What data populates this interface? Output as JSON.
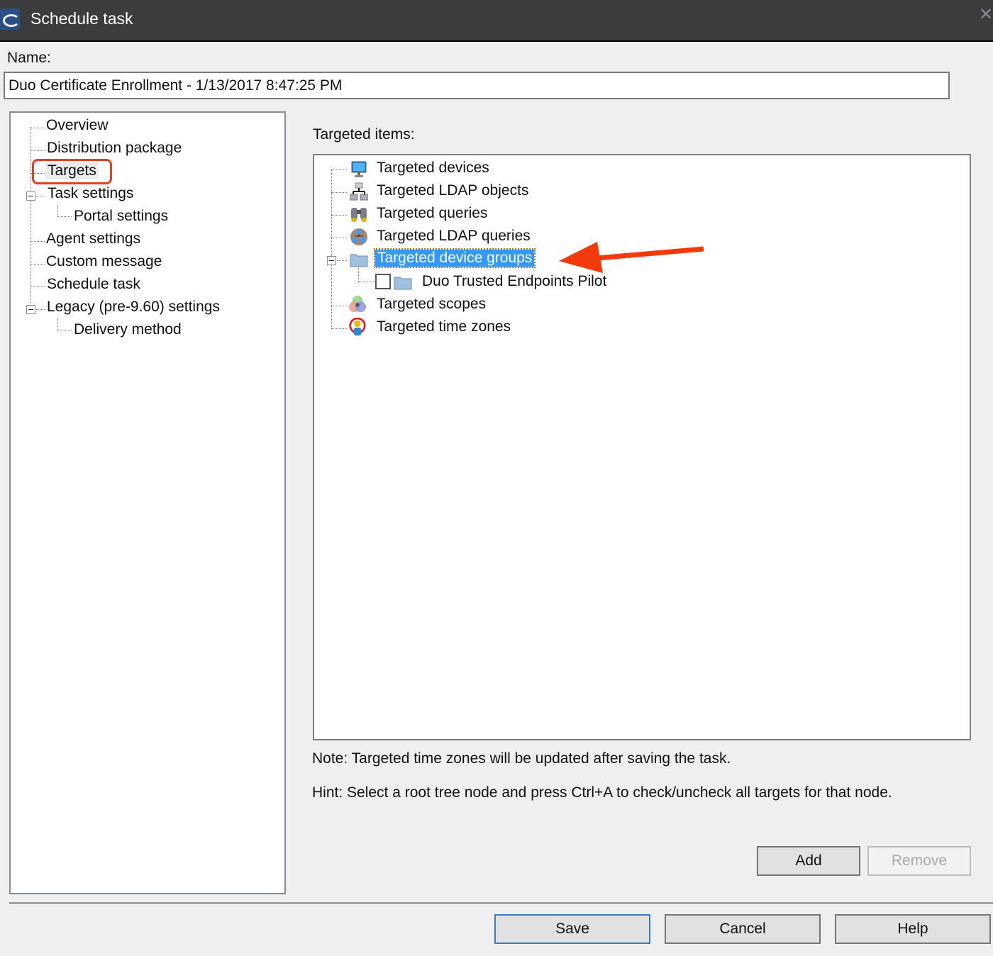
{
  "window": {
    "title": "Schedule task",
    "app_icon": "ivanti-task-icon",
    "close_icon": "close-icon"
  },
  "name_field": {
    "label": "Name:",
    "value": "Duo Certificate Enrollment - 1/13/2017 8:47:25 PM"
  },
  "nav_tree": {
    "items": [
      {
        "label": "Overview",
        "level": 0
      },
      {
        "label": "Distribution package",
        "level": 0
      },
      {
        "label": "Targets",
        "level": 0,
        "highlighted": true
      },
      {
        "label": "Task settings",
        "level": 0,
        "expanded": true
      },
      {
        "label": "Portal settings",
        "level": 1
      },
      {
        "label": "Agent settings",
        "level": 0
      },
      {
        "label": "Custom message",
        "level": 0
      },
      {
        "label": "Schedule task",
        "level": 0
      },
      {
        "label": "Legacy (pre-9.60) settings",
        "level": 0,
        "expanded": true
      },
      {
        "label": "Delivery method",
        "level": 1
      }
    ]
  },
  "targets": {
    "label": "Targeted items:",
    "items": [
      {
        "label": "Targeted devices",
        "icon": "monitor-icon"
      },
      {
        "label": "Targeted LDAP objects",
        "icon": "ldap-hierarchy-icon"
      },
      {
        "label": "Targeted queries",
        "icon": "binoculars-icon"
      },
      {
        "label": "Targeted LDAP queries",
        "icon": "ldap-query-icon"
      },
      {
        "label": "Targeted device groups",
        "icon": "folder-icon",
        "selected": true,
        "expanded": true,
        "children": [
          {
            "label": "Duo Trusted Endpoints Pilot",
            "icon": "folder-icon",
            "checked": false
          }
        ]
      },
      {
        "label": "Targeted scopes",
        "icon": "scopes-icon"
      },
      {
        "label": "Targeted time zones",
        "icon": "time-zone-person-icon"
      }
    ]
  },
  "note": "Note: Targeted time zones will be updated after saving the task.",
  "hint": "Hint: Select a root tree node and press Ctrl+A to check/uncheck all targets for that node.",
  "buttons": {
    "add": "Add",
    "remove": "Remove",
    "save": "Save",
    "cancel": "Cancel",
    "help": "Help"
  },
  "colors": {
    "selection": "#3399ff",
    "annotation": "#e8401c",
    "titlebar": "#3c3c3c"
  }
}
